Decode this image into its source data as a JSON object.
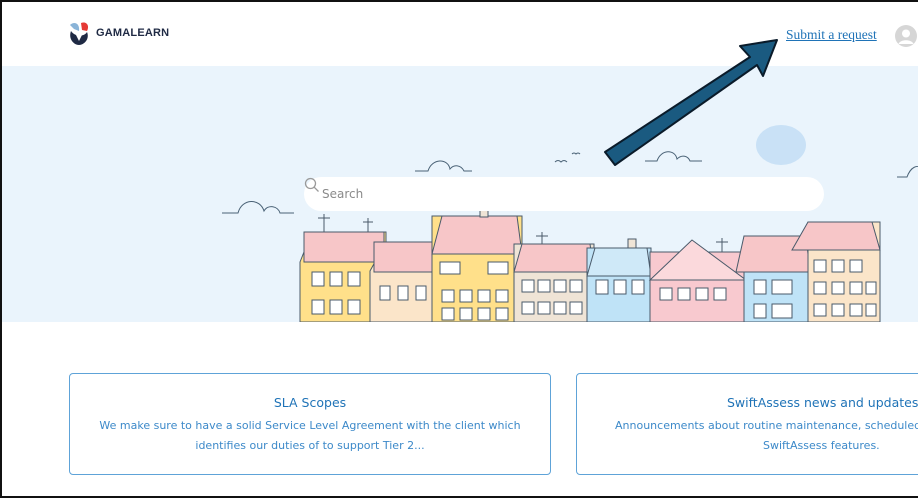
{
  "header": {
    "logo_text": "GAMALEARN",
    "submit_request_label": "Submit a request"
  },
  "search": {
    "placeholder": "Search"
  },
  "cards": [
    {
      "title": "SLA Scopes",
      "description_line1": "We make sure to have a solid Service Level Agreement with the client which",
      "description_line2": "identifies our duties of to support Tier 2..."
    },
    {
      "title": "SwiftAssess news and updates",
      "description_line1": "Announcements about routine maintenance, scheduled o",
      "description_line2": "SwiftAssess features."
    }
  ],
  "colors": {
    "link": "#1f73b7",
    "hero_bg": "#eaf4fc",
    "card_border": "#5ea3d8",
    "annotation_arrow": "#1a5a80"
  },
  "icons": {
    "logo": "gamalearn-logo-icon",
    "avatar": "user-avatar-icon",
    "search": "search-icon",
    "annotation": "arrow-annotation-icon"
  }
}
